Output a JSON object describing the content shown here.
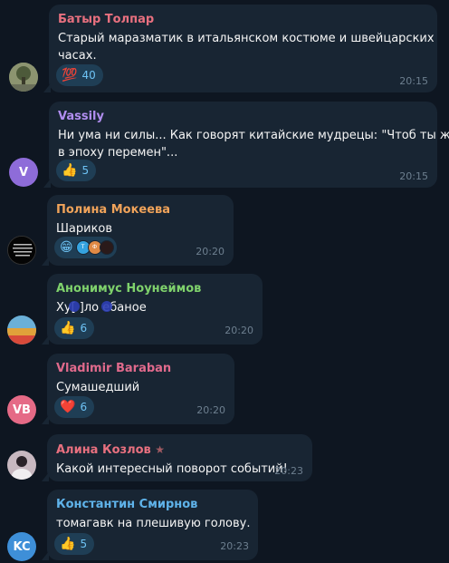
{
  "chat": {
    "messages": [
      {
        "author": "Батыр Толпар",
        "author_color": "#e8707f",
        "text_lines": [
          "Старый маразматик в итальянском костюме и швейцарских",
          "часах."
        ],
        "reaction": {
          "icon": "hundred-points-icon",
          "emoji": "💯",
          "count": "40"
        },
        "time": "20:15",
        "avatar": {
          "type": "photo",
          "icon": "tree-photo-avatar"
        }
      },
      {
        "author": "Vassily",
        "author_color": "#b18ef0",
        "text_lines": [
          "Ни ума ни силы... Как говорят китайские мудрецы: \"Чтоб ты жил",
          "в эпоху перемен\"..."
        ],
        "reaction": {
          "icon": "thumbs-up-icon",
          "emoji": "👍",
          "count": "5"
        },
        "time": "20:15",
        "avatar": {
          "type": "initials",
          "initials": "V",
          "color": "#8e6cd9"
        }
      },
      {
        "author": "Полина Мокеева",
        "author_color": "#f0a35a",
        "text_lines": [
          "Шариков"
        ],
        "reaction": {
          "icon": "grinning-face-icon",
          "emoji": "😁",
          "reactor_initials": [
            "Т",
            "Ф"
          ],
          "reactor_colors": [
            "#35a3e0",
            "#e08a45"
          ]
        },
        "time": "20:20",
        "avatar": {
          "type": "photo",
          "icon": "text-quote-avatar"
        }
      },
      {
        "author": "Анонимус Ноунеймов",
        "author_color": "#7fd26c",
        "text_lines": [
          "Ху[ ]ло ебаное"
        ],
        "text_visible": "Хуйло ебаное",
        "reaction": {
          "icon": "thumbs-up-icon",
          "emoji": "👍",
          "count": "6"
        },
        "time": "20:20",
        "avatar": {
          "type": "photo",
          "icon": "tulip-field-avatar"
        }
      },
      {
        "author": "Vladimir Baraban",
        "author_color": "#e06a8c",
        "text_lines": [
          "Сумашедший"
        ],
        "reaction": {
          "icon": "red-heart-icon",
          "emoji": "❤️",
          "count": "6"
        },
        "time": "20:20",
        "avatar": {
          "type": "initials",
          "initials": "VB",
          "color": "#e56a86"
        }
      },
      {
        "author": "Алина Козлов",
        "author_color": "#e8707f",
        "author_badge": "★",
        "text_lines": [
          "Какой интересный поворот событий!"
        ],
        "time": "20:23",
        "avatar": {
          "type": "photo",
          "icon": "person-photo-avatar"
        }
      },
      {
        "author": "Константин Смирнов",
        "author_color": "#5fb3ea",
        "text_lines": [
          "томагавк на плешивую голову."
        ],
        "reaction": {
          "icon": "thumbs-up-icon",
          "emoji": "👍",
          "count": "5"
        },
        "time": "20:23",
        "avatar": {
          "type": "initials",
          "initials": "KC",
          "color": "#3e8fd8"
        }
      }
    ]
  }
}
